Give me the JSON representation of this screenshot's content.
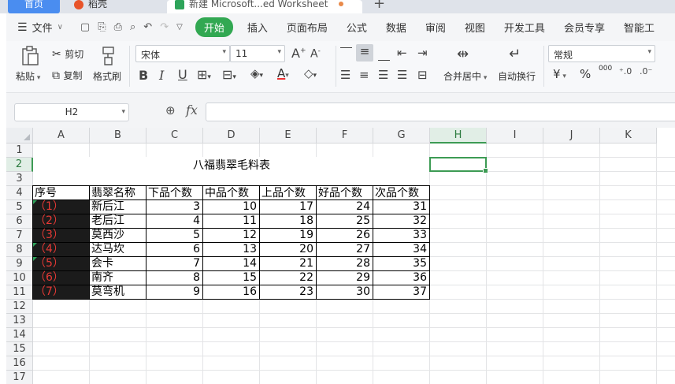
{
  "tabs": {
    "home": "首页",
    "docer": "稻壳",
    "workbook": "新建 Microsoft...ed Worksheet",
    "new_tab": "+"
  },
  "menu": {
    "file": "文件",
    "start": "开始",
    "items": [
      "插入",
      "页面布局",
      "公式",
      "数据",
      "审阅",
      "视图",
      "开发工具",
      "会员专享",
      "智能工"
    ]
  },
  "ribbon": {
    "paste": "粘贴",
    "cut": "剪切",
    "copy": "复制",
    "format_painter": "格式刷",
    "font_name": "宋体",
    "font_size": "11",
    "merge_center": "合并居中",
    "wrap_text": "自动换行",
    "number_format": "常规",
    "currency_symbol": "¥",
    "percent_symbol": "%",
    "thousands_symbol": "000"
  },
  "formula_bar": {
    "name_box": "H2",
    "fx": "fx",
    "formula": ""
  },
  "sheet": {
    "columns": [
      "A",
      "B",
      "C",
      "D",
      "E",
      "F",
      "G",
      "H",
      "I",
      "J",
      "K"
    ],
    "active_column": "H",
    "rows": [
      "1",
      "2",
      "3",
      "4",
      "5",
      "6",
      "7",
      "8",
      "9",
      "10",
      "11",
      "12",
      "13",
      "14",
      "15",
      "16",
      "17"
    ],
    "active_row": "2",
    "title": "八福翡翠毛料表",
    "headers": [
      "序号",
      "翡翠名称",
      "下品个数",
      "中品个数",
      "上品个数",
      "好品个数",
      "次品个数"
    ],
    "records": [
      {
        "seq": "（1）",
        "name": "新后江",
        "low": "3",
        "mid": "10",
        "high": "17",
        "good": "24",
        "defect": "31"
      },
      {
        "seq": "（2）",
        "name": "老后江",
        "low": "4",
        "mid": "11",
        "high": "18",
        "good": "25",
        "defect": "32"
      },
      {
        "seq": "（3）",
        "name": "莫西沙",
        "low": "5",
        "mid": "12",
        "high": "19",
        "good": "26",
        "defect": "33"
      },
      {
        "seq": "（4）",
        "name": "达马坎",
        "low": "6",
        "mid": "13",
        "high": "20",
        "good": "27",
        "defect": "34"
      },
      {
        "seq": "（5）",
        "name": "会卡",
        "low": "7",
        "mid": "14",
        "high": "21",
        "good": "28",
        "defect": "35"
      },
      {
        "seq": "（6）",
        "name": "南齐",
        "low": "8",
        "mid": "15",
        "high": "22",
        "good": "29",
        "defect": "36"
      },
      {
        "seq": "（7）",
        "name": "莫弯机",
        "low": "9",
        "mid": "16",
        "high": "23",
        "good": "30",
        "defect": "37"
      }
    ]
  }
}
